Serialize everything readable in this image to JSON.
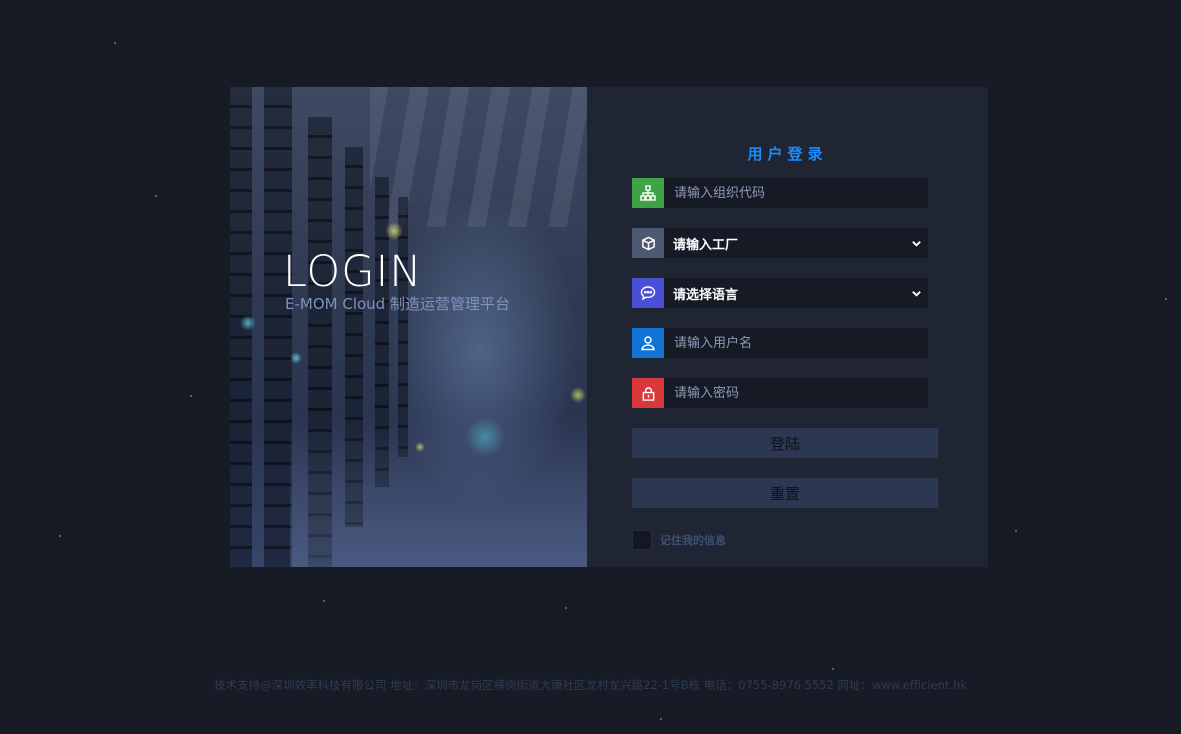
{
  "hero": {
    "title": "LOGIN",
    "subtitle": "E-MOM Cloud 制造运营管理平台"
  },
  "form": {
    "title": "用户登录",
    "org_code": {
      "placeholder": "请输入组织代码",
      "icon": "sitemap-icon",
      "icon_color": "#3ea345"
    },
    "factory": {
      "value": "请输入工厂",
      "icon": "cube-icon",
      "icon_color": "#4d5872"
    },
    "language": {
      "value": "请选择语言",
      "icon": "chat-bubble-icon",
      "icon_color": "#4b4fd6"
    },
    "username": {
      "placeholder": "请输入用户名",
      "icon": "user-icon",
      "icon_color": "#1173d4"
    },
    "password": {
      "placeholder": "请输入密码",
      "icon": "lock-icon",
      "icon_color": "#d9393a"
    },
    "login_label": "登陆",
    "reset_label": "重置",
    "remember_label": "记住我的信息"
  },
  "footer": {
    "text": "技术支持@深圳效率科技有限公司  地址：深圳市龙岗区横岗街道大康社区龙村龙兴路22-1号B栋  电话：0755-8976 5552  网址：www.efficient.hk"
  },
  "colors": {
    "background": "#171b26",
    "panel": "#1f2533",
    "accent": "#1a8cff",
    "button": "#2c3751"
  }
}
